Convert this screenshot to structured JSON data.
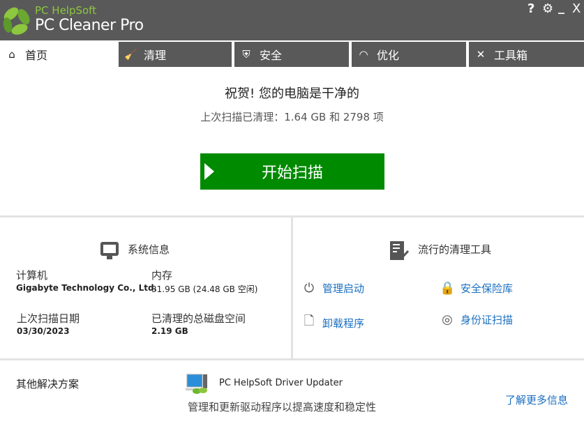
{
  "header": {
    "brand_top": "PC HelpSoft",
    "brand_main": "PC Cleaner Pro"
  },
  "window_controls": {
    "help": "?",
    "settings": "⚙",
    "minimize": "_",
    "close": "X"
  },
  "tabs": [
    {
      "label": "首页",
      "icon": "home-icon"
    },
    {
      "label": "清理",
      "icon": "broom-icon"
    },
    {
      "label": "安全",
      "icon": "shield-icon"
    },
    {
      "label": "优化",
      "icon": "speedometer-icon"
    },
    {
      "label": "工具箱",
      "icon": "tools-icon"
    }
  ],
  "status": {
    "title": "祝贺! 您的电脑是干净的",
    "last_cleaned": "上次扫描已清理：1.64 GB 和 2798 项"
  },
  "scan_button": "开始扫描",
  "system_info": {
    "title": "系统信息",
    "computer_label": "计算机",
    "computer_value": "Gigabyte Technology Co., Ltd.",
    "memory_label": "内存",
    "memory_value": "31.95 GB (24.48 GB 空闲)",
    "last_scan_label": "上次扫描日期",
    "last_scan_value": "03/30/2023",
    "cleaned_label": "已清理的总磁盘空间",
    "cleaned_value": "2.19 GB"
  },
  "tools": {
    "title": "流行的清理工具",
    "items": [
      "管理启动",
      "安全保险库",
      "卸载程序",
      "身份证扫描"
    ]
  },
  "other": {
    "title": "其他解决方案",
    "product": "PC HelpSoft Driver Updater",
    "description": "管理和更新驱动程序以提高速度和稳定性",
    "learn_more": "了解更多信息"
  }
}
